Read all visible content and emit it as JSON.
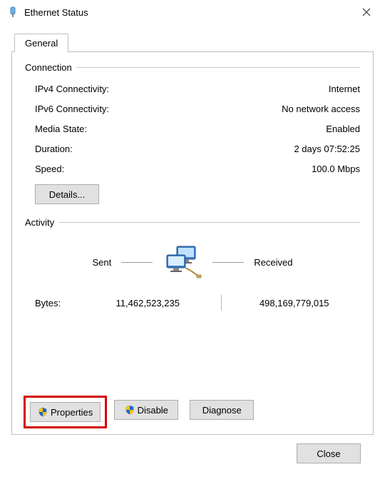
{
  "window": {
    "title": "Ethernet Status"
  },
  "tabs": {
    "general": "General"
  },
  "groups": {
    "connection": "Connection",
    "activity": "Activity"
  },
  "connection": {
    "ipv4_label": "IPv4 Connectivity:",
    "ipv4_value": "Internet",
    "ipv6_label": "IPv6 Connectivity:",
    "ipv6_value": "No network access",
    "media_label": "Media State:",
    "media_value": "Enabled",
    "duration_label": "Duration:",
    "duration_value": "2 days 07:52:25",
    "speed_label": "Speed:",
    "speed_value": "100.0 Mbps"
  },
  "activity": {
    "sent_label": "Sent",
    "received_label": "Received",
    "bytes_label": "Bytes:",
    "bytes_sent": "11,462,523,235",
    "bytes_received": "498,169,779,015"
  },
  "buttons": {
    "details": "Details...",
    "properties": "Properties",
    "disable": "Disable",
    "diagnose": "Diagnose",
    "close": "Close"
  }
}
